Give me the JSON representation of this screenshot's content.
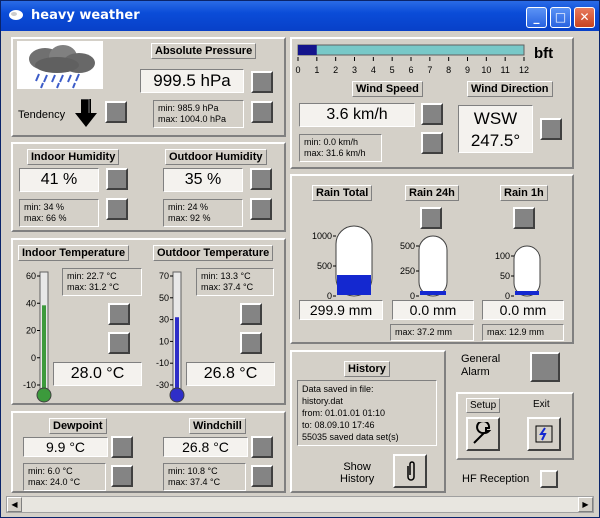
{
  "window": {
    "title": "heavy weather"
  },
  "pressure": {
    "header": "Absolute Pressure",
    "value": "999.5 hPa",
    "min": "min: 985.9 hPa",
    "max": "max: 1004.0 hPa",
    "tendency_label": "Tendency"
  },
  "wind": {
    "scale_unit": "bft",
    "scale_ticks": [
      "0",
      "1",
      "2",
      "3",
      "4",
      "5",
      "6",
      "7",
      "8",
      "9",
      "10",
      "11",
      "12"
    ],
    "bft_level_fraction": 0.083,
    "speed_header": "Wind Speed",
    "speed_value": "3.6 km/h",
    "speed_min": "min: 0.0 km/h",
    "speed_max": "max: 31.6 km/h",
    "dir_header": "Wind Direction",
    "dir_value": "WSW",
    "dir_degrees": "247.5°"
  },
  "humidity": {
    "indoor_header": "Indoor Humidity",
    "indoor_value": "41 %",
    "indoor_min": "min: 34 %",
    "indoor_max": "max: 66 %",
    "outdoor_header": "Outdoor Humidity",
    "outdoor_value": "35 %",
    "outdoor_min": "min: 24 %",
    "outdoor_max": "max: 92 %"
  },
  "rain": {
    "total_header": "Rain Total",
    "total_value": "299.9 mm",
    "total_ticks": [
      "1000",
      "500",
      "0"
    ],
    "total_fill": 0.3,
    "h24_header": "Rain 24h",
    "h24_value": "0.0 mm",
    "h24_ticks": [
      "500",
      "250",
      "0"
    ],
    "h24_max": "max: 37.2 mm",
    "h1_header": "Rain 1h",
    "h1_value": "0.0 mm",
    "h1_ticks": [
      "100",
      "50",
      "0"
    ],
    "h1_max": "max: 12.9 mm"
  },
  "temperature": {
    "indoor_header": "Indoor Temperature",
    "indoor_value": "28.0 °C",
    "indoor_min": "min: 22.7 °C",
    "indoor_max": "max: 31.2 °C",
    "indoor_ticks": [
      "60",
      "40",
      "20",
      "0",
      "-10"
    ],
    "outdoor_header": "Outdoor Temperature",
    "outdoor_value": "26.8 °C",
    "outdoor_min": "min: 13.3 °C",
    "outdoor_max": "max: 37.4 °C",
    "outdoor_ticks": [
      "70",
      "50",
      "30",
      "10",
      "-10",
      "-30"
    ]
  },
  "history": {
    "header": "History",
    "line1": "Data saved in file:",
    "line2": "history.dat",
    "line3": "from: 01.01.01 01:10",
    "line4": "to:      08.09.10 17:46",
    "line5": "55035 saved data set(s)",
    "show_label_1": "Show",
    "show_label_2": "History"
  },
  "alarm": {
    "label_1": "General",
    "label_2": "Alarm"
  },
  "controls": {
    "setup_label": "Setup",
    "exit_label": "Exit",
    "hf_label": "HF Reception"
  },
  "dewpoint": {
    "header": "Dewpoint",
    "value": "9.9 °C",
    "min": "min: 6.0 °C",
    "max": "max: 24.0 °C"
  },
  "windchill": {
    "header": "Windchill",
    "value": "26.8 °C",
    "min": "min: 10.8 °C",
    "max": "max: 37.4 °C"
  },
  "colors": {
    "title_bar": "#0a4cd8",
    "indoor_thermo": "#3c9a3c",
    "outdoor_thermo": "#2e2ec8",
    "rain_fill": "#1428d0",
    "wind_bar": "#78c8c8",
    "wind_fill": "#14148c"
  }
}
